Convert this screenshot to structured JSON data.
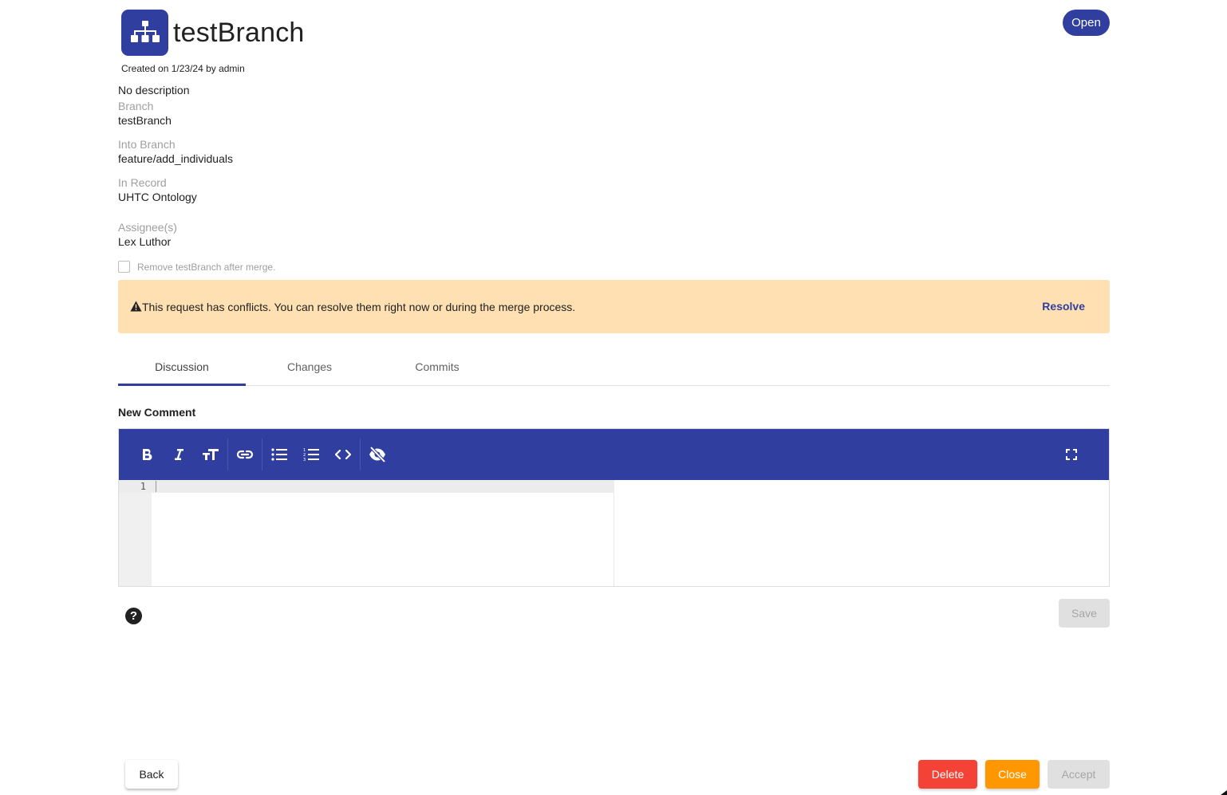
{
  "header": {
    "icon": "sitemap-icon",
    "title": "testBranch",
    "created_text": "Created on 1/23/24 by admin",
    "status": "Open"
  },
  "info": {
    "description": "No description",
    "fields": [
      {
        "label": "Branch",
        "value": "testBranch"
      },
      {
        "label": "Into Branch",
        "value": "feature/add_individuals"
      },
      {
        "label": "In Record",
        "value": "UHTC Ontology"
      },
      {
        "label": "Assignee(s)",
        "value": "Lex Luthor"
      }
    ],
    "remove_branch_checkbox": {
      "label": "Remove testBranch after merge.",
      "checked": false
    }
  },
  "alert": {
    "icon": "warning-icon",
    "text": "This request has conflicts. You can resolve them right now or during the merge process.",
    "action_label": "Resolve"
  },
  "tabs": [
    {
      "label": "Discussion",
      "active": true
    },
    {
      "label": "Changes",
      "active": false
    },
    {
      "label": "Commits",
      "active": false
    }
  ],
  "comment": {
    "heading": "New Comment",
    "toolbar": [
      {
        "name": "bold-icon",
        "title": "Bold"
      },
      {
        "name": "italic-icon",
        "title": "Italic"
      },
      {
        "name": "heading-icon",
        "title": "Heading"
      },
      {
        "name": "link-icon",
        "title": "Link"
      },
      {
        "name": "bulleted-list-icon",
        "title": "Bulleted List"
      },
      {
        "name": "numbered-list-icon",
        "title": "Numbered List"
      },
      {
        "name": "code-icon",
        "title": "Code"
      },
      {
        "name": "toggle-preview-icon",
        "title": "Toggle Preview"
      },
      {
        "name": "fullscreen-icon",
        "title": "Fullscreen"
      }
    ],
    "line_number": "1",
    "content": "",
    "save_label": "Save"
  },
  "footer": {
    "back_label": "Back",
    "delete_label": "Delete",
    "close_label": "Close",
    "accept_label": "Accept"
  },
  "colors": {
    "primary": "#303f9f",
    "warning_bg": "#ffe0b2",
    "danger": "#f44336",
    "orange": "#ff9800",
    "disabled": "#e0e0e0"
  }
}
